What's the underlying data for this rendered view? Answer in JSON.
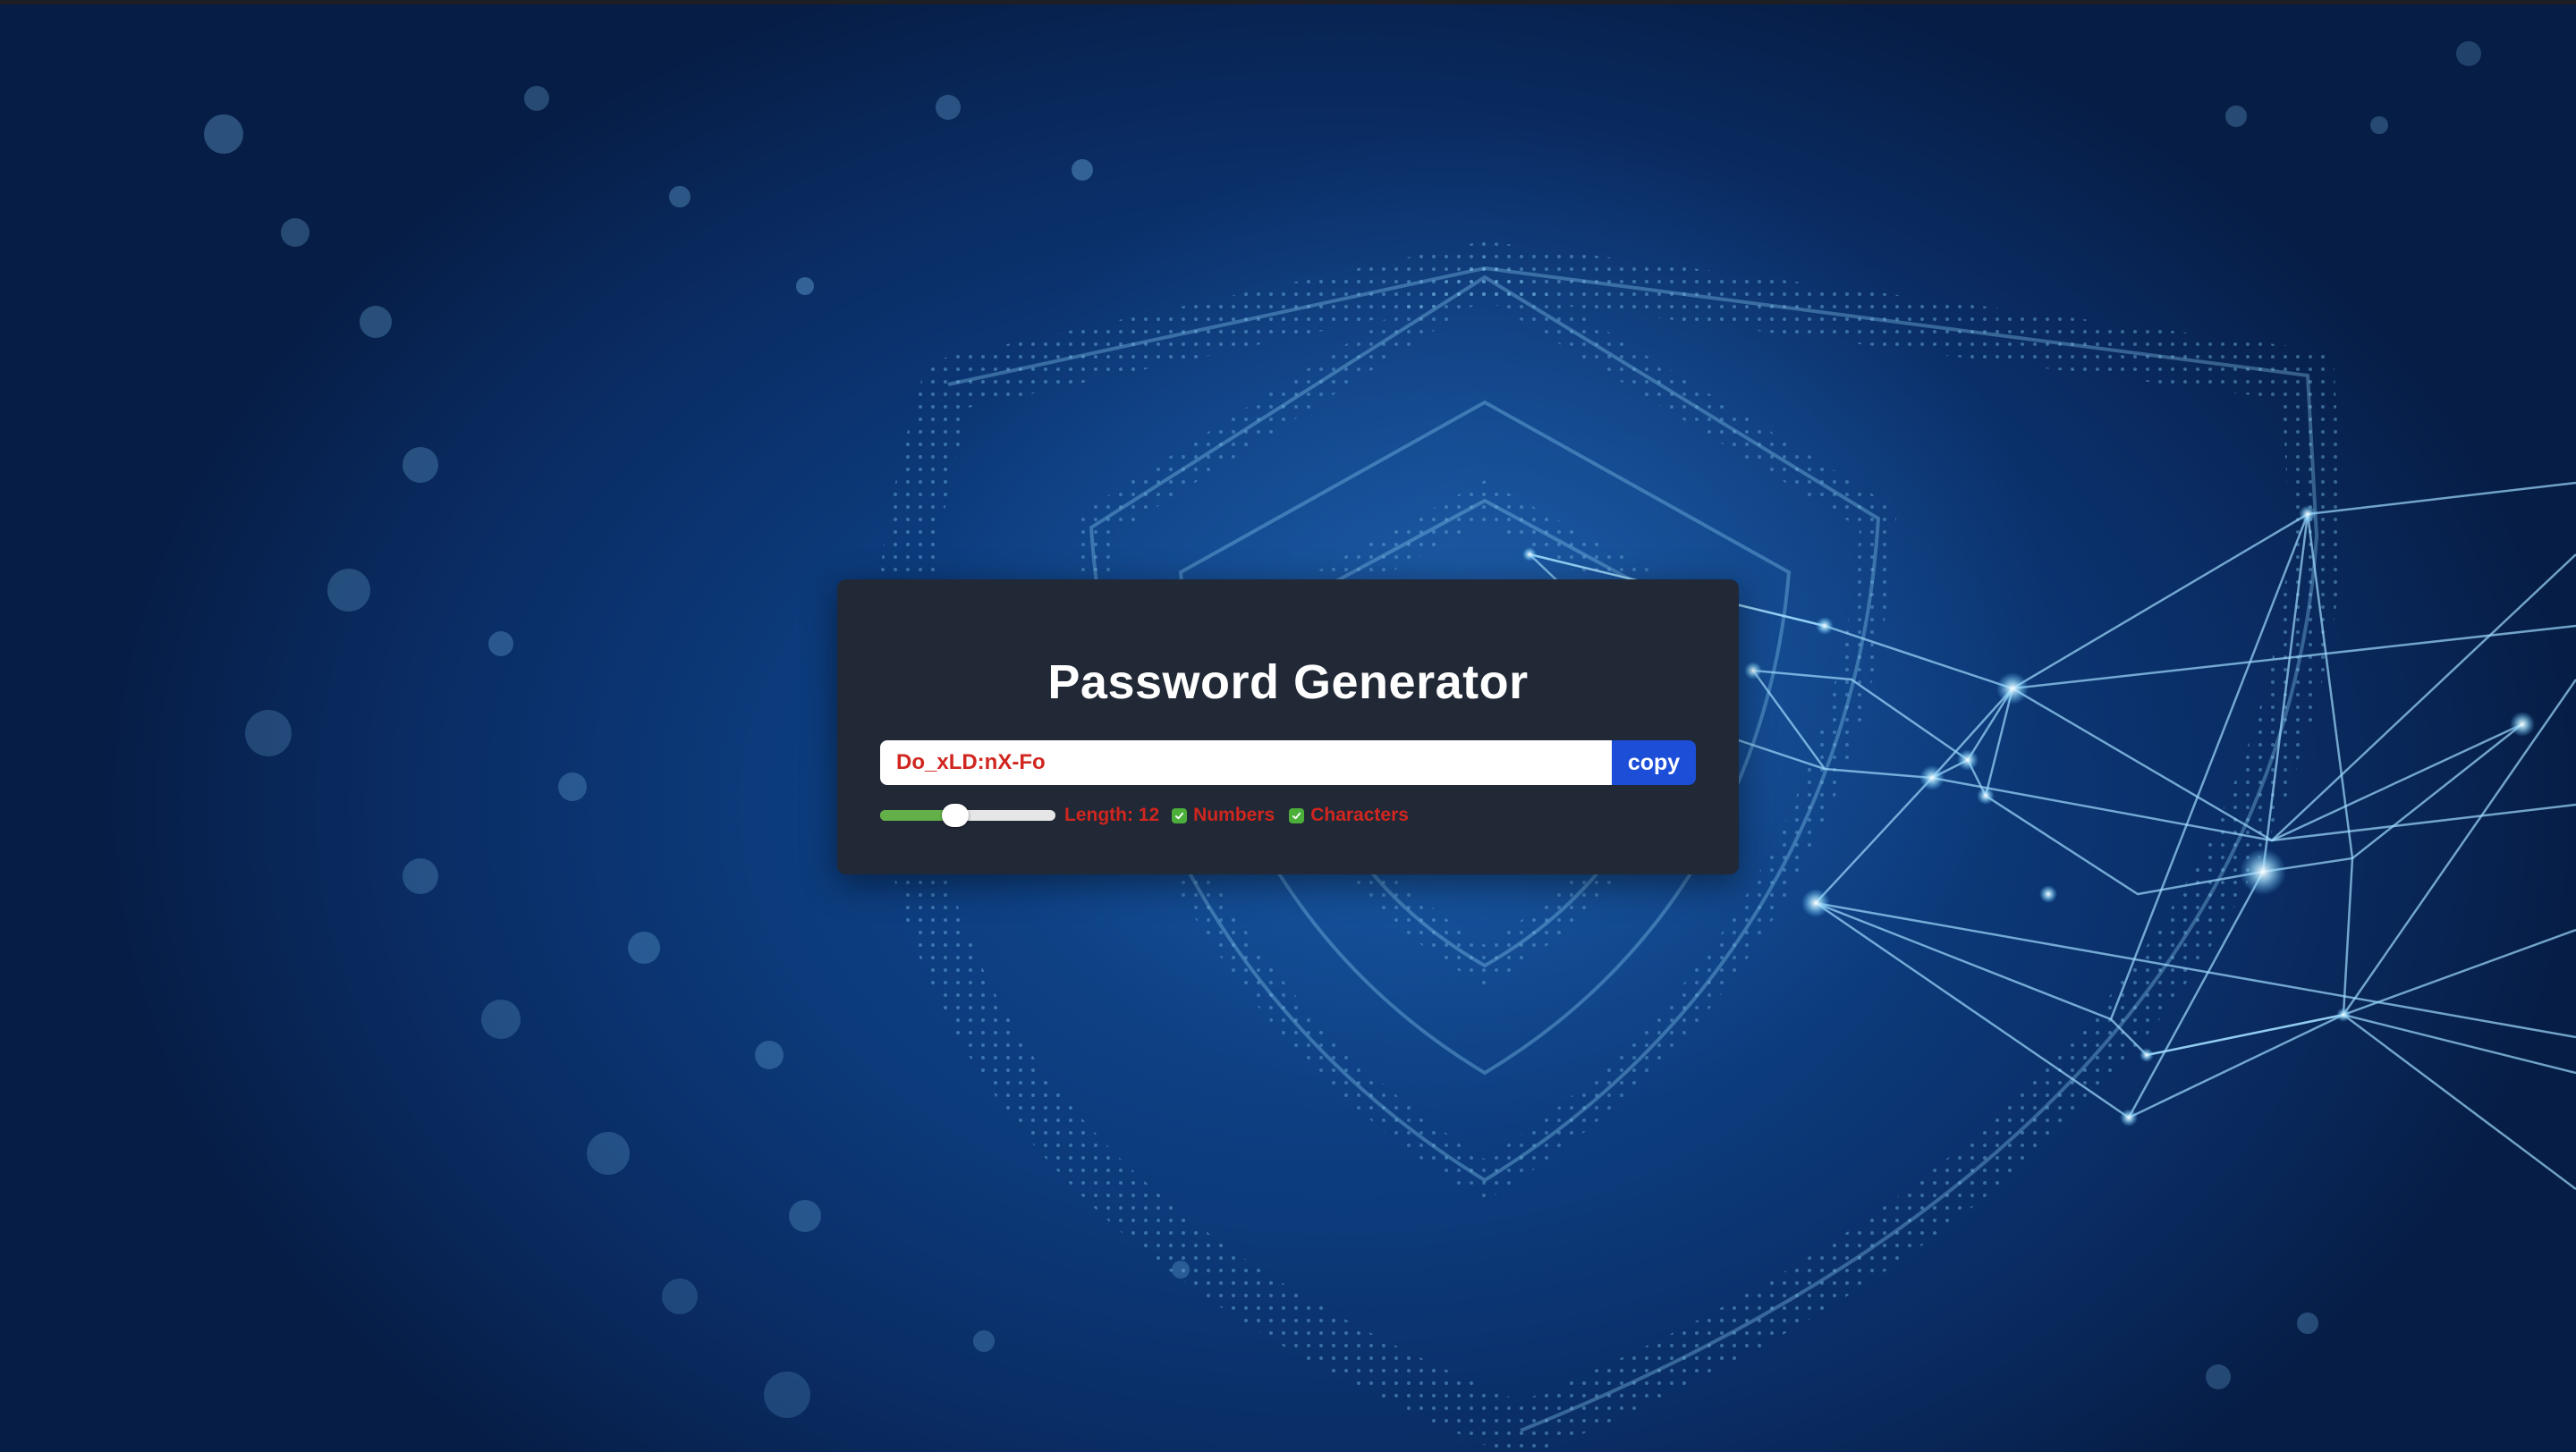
{
  "title": "Password Generator",
  "password": {
    "value": "Do_xLD:nX-Fo"
  },
  "copy_button": {
    "label": "copy"
  },
  "length": {
    "label": "Length: 12",
    "value": 12,
    "slider_fraction": 0.43
  },
  "options": {
    "numbers": {
      "label": "Numbers",
      "checked": true
    },
    "characters": {
      "label": "Characters",
      "checked": true
    }
  },
  "colors": {
    "card_background": "#212836",
    "accent_text": "#d0261f",
    "copy_button": "#1d4ed8",
    "slider_fill": "#62b047",
    "checkbox": "#4caf3a"
  },
  "icons": {
    "checkbox": "checkmark-icon",
    "background": "shield-icon"
  }
}
